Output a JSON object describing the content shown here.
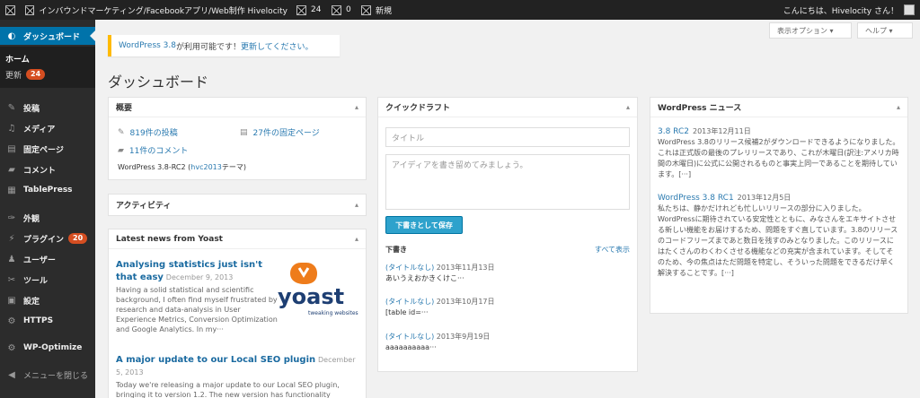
{
  "adminbar": {
    "site_title": "インバウンドマーケティング/Facebookアプリ/Web制作 Hivelocity",
    "comments_count": "24",
    "new_count": "0",
    "new_label": "新規",
    "greeting": "こんにちは、Hivelocity さん！"
  },
  "menu": {
    "dashboard": "ダッシュボード",
    "sub_home": "ホーム",
    "sub_updates": "更新",
    "sub_updates_badge": "24",
    "items": [
      {
        "label": "投稿",
        "icon": "pin-icon"
      },
      {
        "label": "メディア",
        "icon": "media-icon"
      },
      {
        "label": "固定ページ",
        "icon": "page-icon"
      },
      {
        "label": "コメント",
        "icon": "comment-icon"
      },
      {
        "label": "TablePress",
        "icon": "table-icon"
      },
      {
        "label": "外観",
        "icon": "appearance-icon"
      },
      {
        "label": "プラグイン",
        "icon": "plugin-icon",
        "badge": "20"
      },
      {
        "label": "ユーザー",
        "icon": "user-icon"
      },
      {
        "label": "ツール",
        "icon": "tool-icon"
      },
      {
        "label": "設定",
        "icon": "settings-icon"
      },
      {
        "label": "HTTPS",
        "icon": "gear-icon"
      },
      {
        "label": "WP-Optimize",
        "icon": "optimize-icon"
      },
      {
        "label": "メニューを閉じる",
        "icon": "collapse-icon"
      }
    ]
  },
  "top": {
    "screen_options": "表示オプション",
    "help": "ヘルプ"
  },
  "notice": {
    "version_link": "WordPress 3.8",
    "text": " が利用可能です！",
    "update_link": "更新してください。"
  },
  "page_title": "ダッシュボード",
  "glance": {
    "title": "概要",
    "posts": "819件の投稿",
    "pages": "27件の固定ページ",
    "comments": "11件のコメント",
    "version_text": "WordPress 3.8-RC2 (",
    "theme_link": "hvc2013",
    "theme_suffix": " テーマ)"
  },
  "activity": {
    "title": "アクティビティ"
  },
  "yoast": {
    "title": "Latest news from Yoast",
    "logo_text": "yoast",
    "logo_tagline": "tweaking websites",
    "items": [
      {
        "title": "Analysing statistics just isn't that easy",
        "date": "December 9, 2013",
        "excerpt": "Having a solid statistical and scientific background, I often find myself frustrated by research and data-analysis in User Experience Metrics, Conversion Optimization and Google Analytics. In my···"
      },
      {
        "title": "A major update to our Local SEO plugin",
        "date": "December 5, 2013",
        "excerpt": "Today we're releasing a major update to our Local SEO plugin, bringing it to version 1.2. The new version has functionality"
      }
    ]
  },
  "quickdraft": {
    "title": "クイックドラフト",
    "title_placeholder": "タイトル",
    "content_placeholder": "アイディアを書き留めてみましょう。",
    "save_button": "下書きとして保存",
    "drafts_heading": "下書き",
    "view_all": "すべて表示",
    "drafts": [
      {
        "title": "(タイトルなし)",
        "date": "2013年11月13日",
        "excerpt": "あいうえおかきくけこ···"
      },
      {
        "title": "(タイトルなし)",
        "date": "2013年10月17日",
        "excerpt": "[table id=···"
      },
      {
        "title": "(タイトルなし)",
        "date": "2013年9月19日",
        "excerpt": "aaaaaaaaaa···"
      }
    ]
  },
  "wpnews": {
    "title": "WordPress ニュース",
    "items": [
      {
        "title": "3.8 RC2",
        "date": "2013年12月11日",
        "excerpt": "WordPress 3.8のリリース候補2がダウンロードできるようになりました。これは正式版の最後のプレリリースであり、これが木曜日(訳注:アメリカ時間の木曜日)に公式に公開されるものと事実上同一であることを期待しています。[···]"
      },
      {
        "title": "WordPress 3.8 RC1",
        "date": "2013年12月5日",
        "excerpt": "私たちは、静かだけれども忙しいリリースの部分に入りました。WordPressに期待されている安定性とともに、みなさんをエキサイトさせる新しい機能をお届けするため、問題をすぐ直しています。3.8のリリースのコードフリーズまであと数日を残すのみとなりました。このリリースにはたくさんのわくわくさせる機能などの充実が含まれています。そしてそのため、今の焦点はただ問題を特定し、そういった問題をできるだけ早く解決することです。[···]"
      }
    ]
  },
  "colors": {
    "accent": "#0073aa",
    "badge": "#d54e21",
    "notice": "#ffba00",
    "button": "#2ea2cc"
  }
}
